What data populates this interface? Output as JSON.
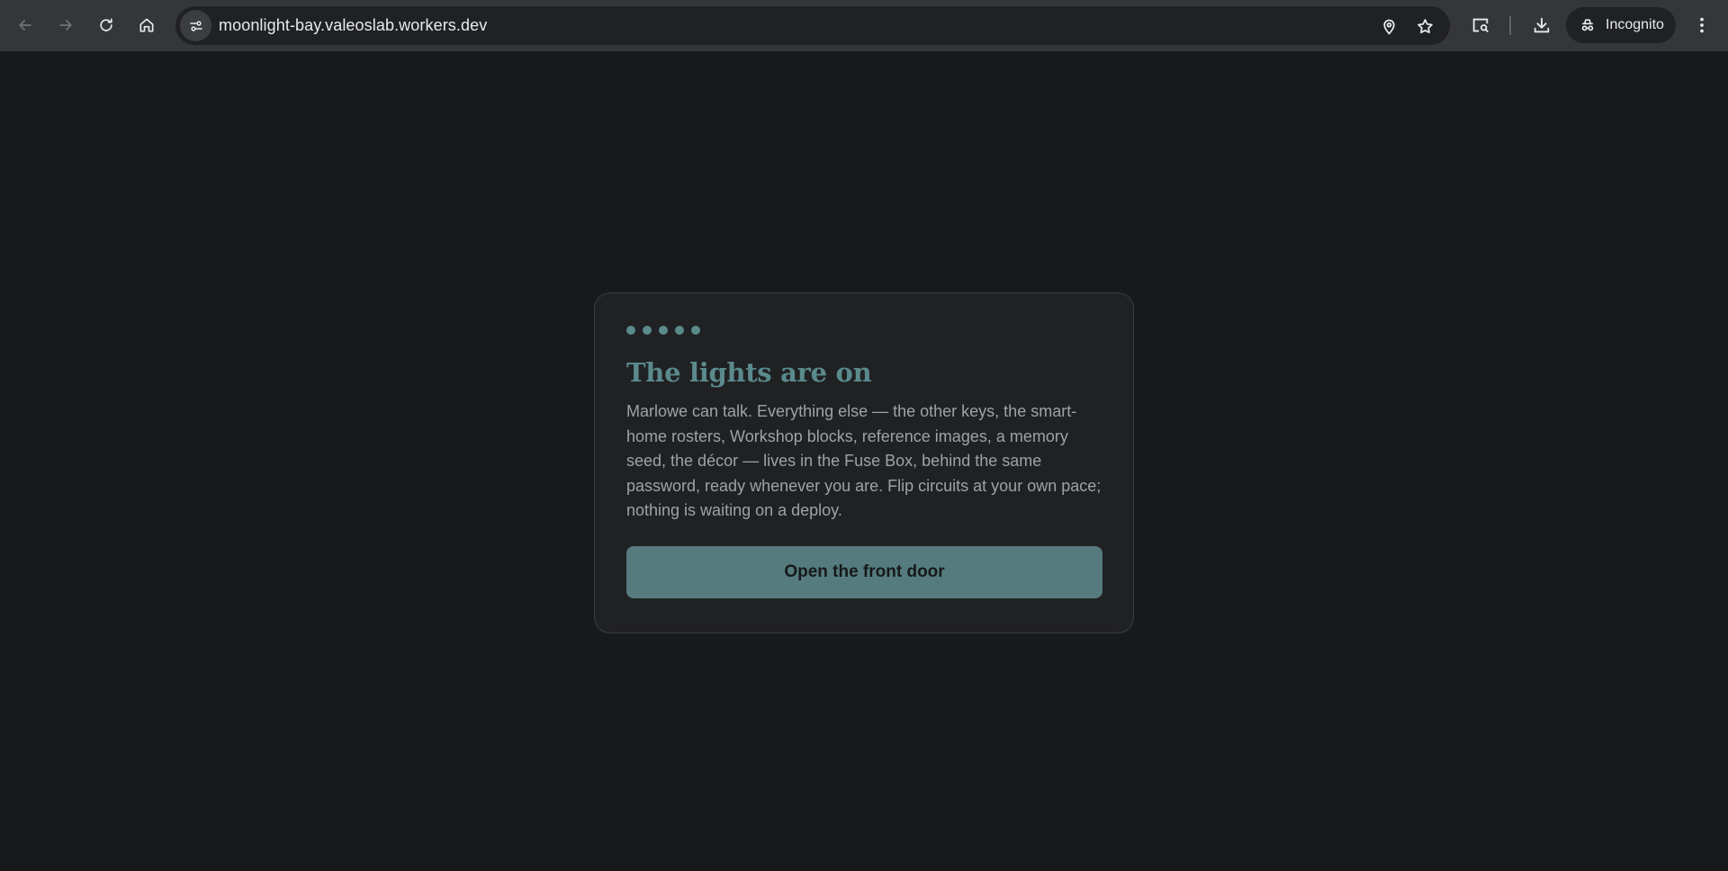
{
  "browser": {
    "url": "moonlight-bay.valeoslab.workers.dev",
    "incognito_label": "Incognito",
    "icons": {
      "back": "back-arrow-icon",
      "forward": "forward-arrow-icon",
      "reload": "reload-icon",
      "home": "home-icon",
      "site_info": "tune-icon",
      "location": "location-pin-icon",
      "bookmark": "star-icon",
      "lens": "search-page-icon",
      "download": "download-icon",
      "incognito": "incognito-icon",
      "menu": "more-vert-icon"
    }
  },
  "card": {
    "dot_count": 5,
    "title": "The lights are on",
    "body": "Marlowe can talk. Everything else — the other keys, the smart-home rosters, Workshop blocks, reference images, a memory seed, the décor — lives in the Fuse Box, behind the same password, ready whenever you are. Flip circuits at your own pace; nothing is waiting on a deploy.",
    "button_label": "Open the front door"
  },
  "colors": {
    "page_background": "#18191b",
    "card_background": "#202123",
    "accent": "#5a8a8c",
    "button": "#567b7e",
    "body_text": "#9ea2a8"
  }
}
